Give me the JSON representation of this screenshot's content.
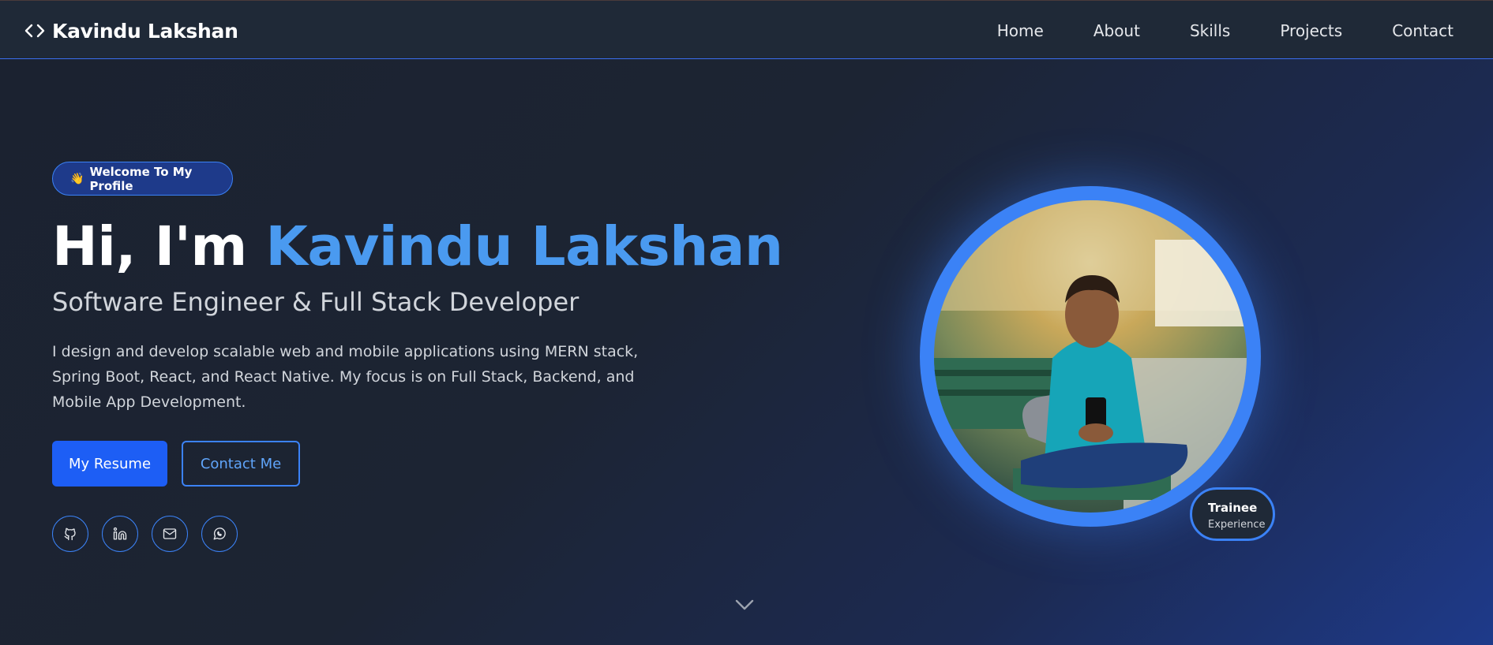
{
  "nav": {
    "brand": "Kavindu Lakshan",
    "brand_icon": "code-brackets-icon",
    "links": [
      "Home",
      "About",
      "Skills",
      "Projects",
      "Contact"
    ]
  },
  "hero": {
    "badge_emoji": "👋",
    "badge_text": "Welcome To My Profile",
    "greeting": "Hi, I'm ",
    "name": "Kavindu Lakshan",
    "subtitle": "Software Engineer & Full Stack Developer",
    "description": "I design and develop scalable web and mobile applications using MERN stack, Spring Boot, React, and React Native. My focus is on Full Stack, Backend, and Mobile App Development.",
    "primary_button": "My Resume",
    "secondary_button": "Contact Me",
    "socials": [
      "github-icon",
      "linkedin-icon",
      "mail-icon",
      "whatsapp-icon"
    ]
  },
  "profile": {
    "badge_title": "Trainee",
    "badge_subtitle": "Experience"
  },
  "colors": {
    "accent": "#3b82f6",
    "name_highlight": "#4a9af0",
    "nav_bg": "#1f2937",
    "primary_button": "#1d5ef5"
  }
}
